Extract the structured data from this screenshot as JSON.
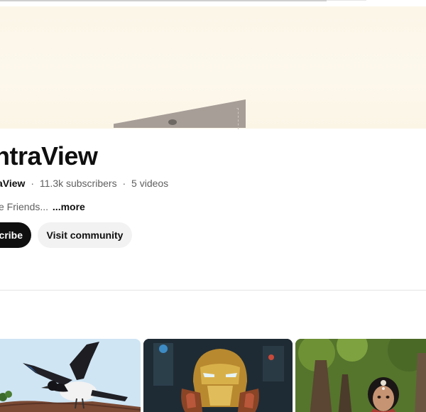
{
  "channel": {
    "title": "ntraView",
    "handle": "aView",
    "subscribers": "11.3k subscribers",
    "videos": "5 videos",
    "separator": "·",
    "description": "e Friends...",
    "more_label": "...more"
  },
  "actions": {
    "subscribe_label": "cribe",
    "community_label": "Visit community"
  },
  "thumbnails": [
    {
      "subject": "bird-in-flight"
    },
    {
      "subject": "child-in-iron-helmet"
    },
    {
      "subject": "woman-in-forest"
    }
  ],
  "colors": {
    "banner": "#fcf7ea",
    "subscribe_bg": "#0f0f0f",
    "community_bg": "#f2f2f2",
    "secondary_text": "#606060"
  }
}
